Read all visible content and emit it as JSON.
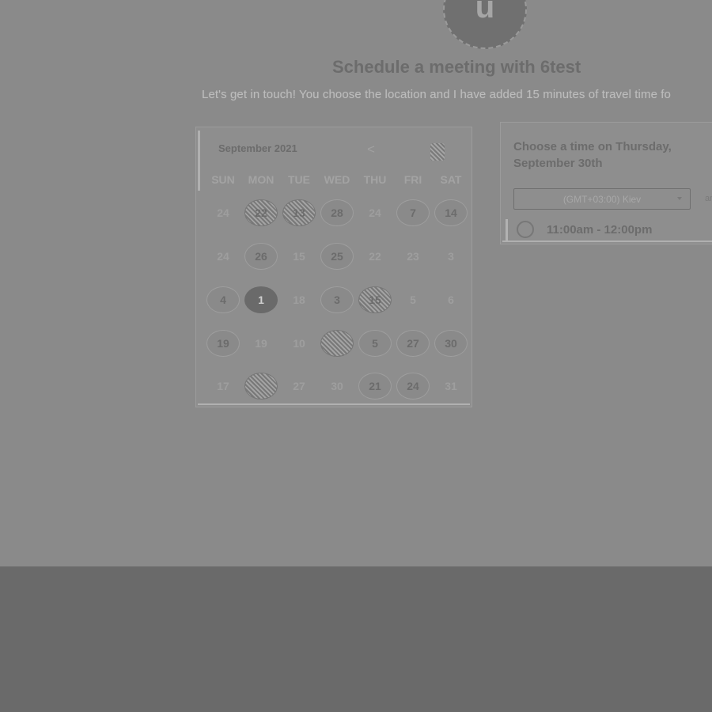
{
  "header": {
    "avatar_initial": "u",
    "title": "Schedule a meeting with 6test",
    "subtitle": "Let's get in touch! You choose the location and I have added 15 minutes of travel time fo"
  },
  "calendar": {
    "month_label": "September 2021",
    "prev_icon": "<",
    "weekdays": [
      "SUN",
      "MON",
      "TUE",
      "WED",
      "THU",
      "FRI",
      "SAT"
    ],
    "rows": [
      [
        {
          "label": "24",
          "state": "disabled"
        },
        {
          "label": "22",
          "state": "noisy"
        },
        {
          "label": "13",
          "state": "noisy"
        },
        {
          "label": "28",
          "state": "available"
        },
        {
          "label": "24",
          "state": "disabled"
        },
        {
          "label": "7",
          "state": "available"
        },
        {
          "label": "14",
          "state": "available"
        }
      ],
      [
        {
          "label": "24",
          "state": "disabled"
        },
        {
          "label": "26",
          "state": "available"
        },
        {
          "label": "15",
          "state": "disabled"
        },
        {
          "label": "25",
          "state": "available"
        },
        {
          "label": "22",
          "state": "disabled"
        },
        {
          "label": "23",
          "state": "disabled"
        },
        {
          "label": "3",
          "state": "disabled"
        }
      ],
      [
        {
          "label": "4",
          "state": "available"
        },
        {
          "label": "1",
          "state": "selected"
        },
        {
          "label": "18",
          "state": "disabled"
        },
        {
          "label": "3",
          "state": "available"
        },
        {
          "label": "15",
          "state": "noisy"
        },
        {
          "label": "5",
          "state": "disabled"
        },
        {
          "label": "6",
          "state": "disabled"
        }
      ],
      [
        {
          "label": "19",
          "state": "available"
        },
        {
          "label": "19",
          "state": "disabled"
        },
        {
          "label": "10",
          "state": "disabled"
        },
        {
          "label": "",
          "state": "noisy"
        },
        {
          "label": "5",
          "state": "available"
        },
        {
          "label": "27",
          "state": "available"
        },
        {
          "label": "30",
          "state": "available"
        }
      ],
      [
        {
          "label": "17",
          "state": "disabled"
        },
        {
          "label": "",
          "state": "noisy"
        },
        {
          "label": "27",
          "state": "disabled"
        },
        {
          "label": "30",
          "state": "disabled"
        },
        {
          "label": "21",
          "state": "available"
        },
        {
          "label": "24",
          "state": "available"
        },
        {
          "label": "31",
          "state": "disabled"
        }
      ]
    ]
  },
  "time_panel": {
    "title": "Choose a time on Thursday, September 30th",
    "timezone": "(GMT+03:00) Kiev",
    "extra": "ar",
    "slots": [
      "11:00am - 12:00pm"
    ]
  },
  "colors": {
    "background": "#8a8a8a",
    "footer": "#6a6a6a",
    "selected_day": "#6a6a6a"
  }
}
